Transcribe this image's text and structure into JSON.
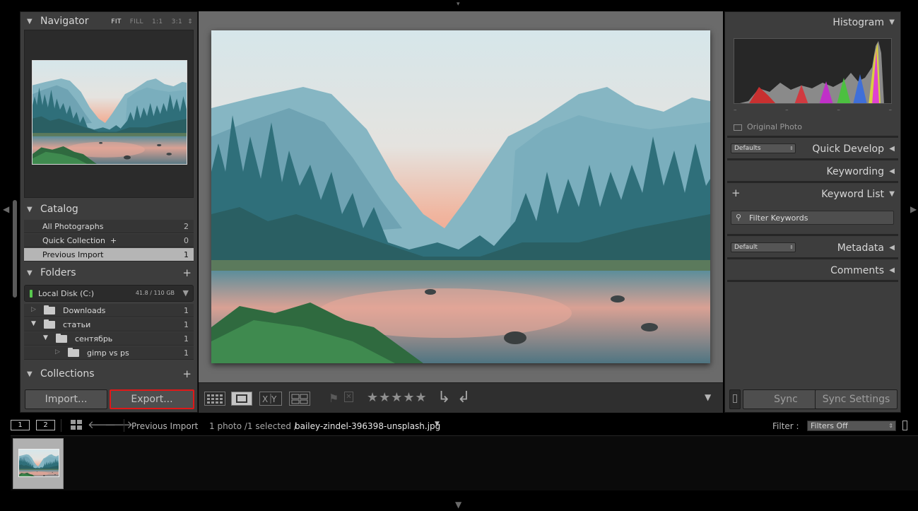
{
  "navigator": {
    "title": "Navigator",
    "zoom_options": [
      "FIT",
      "FILL",
      "1:1",
      "3:1"
    ]
  },
  "catalog": {
    "title": "Catalog",
    "items": [
      {
        "label": "All Photographs",
        "count": "2"
      },
      {
        "label": "Quick Collection  +",
        "count": "0"
      },
      {
        "label": "Previous Import",
        "count": "1"
      }
    ]
  },
  "folders": {
    "title": "Folders",
    "disk_name": "Local Disk (C:)",
    "disk_space": "41.8 / 110 GB",
    "items": [
      {
        "label": "Downloads",
        "count": "1"
      },
      {
        "label": "статьи",
        "count": "1"
      },
      {
        "label": "сентябрь",
        "count": "1"
      },
      {
        "label": "gimp vs ps",
        "count": "1"
      }
    ]
  },
  "collections": {
    "title": "Collections"
  },
  "left_buttons": {
    "import": "Import...",
    "export": "Export..."
  },
  "right": {
    "histogram": "Histogram",
    "original_photo": "Original Photo",
    "quick_develop": "Quick Develop",
    "quick_develop_preset": "Defaults",
    "keywording": "Keywording",
    "keyword_list": "Keyword List",
    "filter_keywords": "Filter Keywords",
    "metadata": "Metadata",
    "metadata_preset": "Default",
    "comments": "Comments",
    "sync": "Sync",
    "sync_settings": "Sync Settings"
  },
  "toolbar": {
    "stars": "★★★★★",
    "rating": 0
  },
  "filmstrip_bar": {
    "monitor1": "1",
    "monitor2": "2",
    "source": "Previous Import",
    "count": "1 photo /1 selected /",
    "filename": "bailey-zindel-396398-unsplash.jpg",
    "filter_label": "Filter :",
    "filter_value": "Filters Off"
  },
  "colors": {
    "panel_bg": "#3d3d3d",
    "center_bg": "#6b6b6b",
    "export_highlight": "#e01818",
    "selected_row": "#b5b5b5"
  }
}
